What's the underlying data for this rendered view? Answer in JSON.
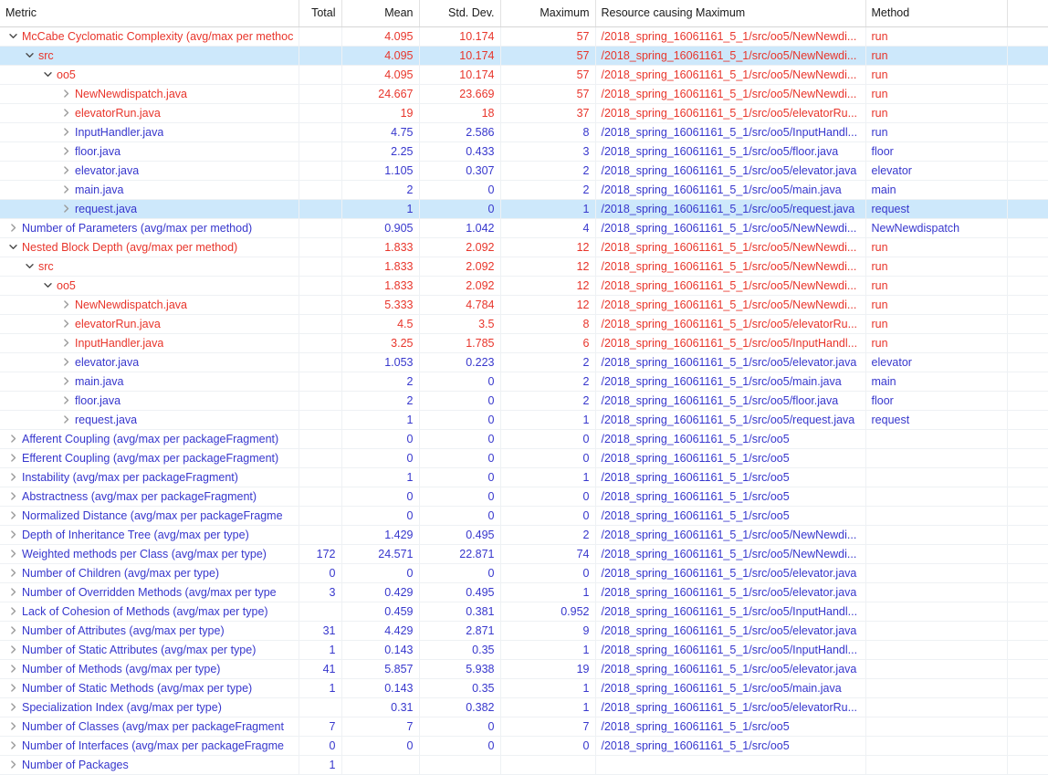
{
  "columns": [
    {
      "key": "metric",
      "label": "Metric",
      "align": "left"
    },
    {
      "key": "total",
      "label": "Total",
      "align": "right"
    },
    {
      "key": "mean",
      "label": "Mean",
      "align": "right"
    },
    {
      "key": "std",
      "label": "Std. Dev.",
      "align": "right"
    },
    {
      "key": "max",
      "label": "Maximum",
      "align": "right"
    },
    {
      "key": "resource",
      "label": "Resource causing Maximum",
      "align": "left"
    },
    {
      "key": "method",
      "label": "Method",
      "align": "left"
    }
  ],
  "icons": {
    "expanded": "chevron-down-icon",
    "collapsed": "chevron-right-icon"
  },
  "colors": {
    "over_threshold": "#e8352b",
    "normal": "#3737cd",
    "selection": "#cde8fb",
    "header_text": "#1a1a1a",
    "grid": "#eef1f4"
  },
  "rows": [
    {
      "label": "McCabe Cyclomatic Complexity (avg/max per methoc",
      "indent": 0,
      "state": "expanded",
      "color": "red",
      "selected": false,
      "total": "",
      "mean": "4.095",
      "std": "10.174",
      "max": "57",
      "resource": "/2018_spring_16061161_5_1/src/oo5/NewNewdi...",
      "method": "run"
    },
    {
      "label": "src",
      "indent": 1,
      "state": "expanded",
      "color": "red",
      "selected": true,
      "total": "",
      "mean": "4.095",
      "std": "10.174",
      "max": "57",
      "resource": "/2018_spring_16061161_5_1/src/oo5/NewNewdi...",
      "method": "run"
    },
    {
      "label": "oo5",
      "indent": 2,
      "state": "expanded",
      "color": "red",
      "selected": false,
      "total": "",
      "mean": "4.095",
      "std": "10.174",
      "max": "57",
      "resource": "/2018_spring_16061161_5_1/src/oo5/NewNewdi...",
      "method": "run"
    },
    {
      "label": "NewNewdispatch.java",
      "indent": 3,
      "state": "collapsed",
      "color": "red",
      "selected": false,
      "total": "",
      "mean": "24.667",
      "std": "23.669",
      "max": "57",
      "resource": "/2018_spring_16061161_5_1/src/oo5/NewNewdi...",
      "method": "run"
    },
    {
      "label": "elevatorRun.java",
      "indent": 3,
      "state": "collapsed",
      "color": "red",
      "selected": false,
      "total": "",
      "mean": "19",
      "std": "18",
      "max": "37",
      "resource": "/2018_spring_16061161_5_1/src/oo5/elevatorRu...",
      "method": "run"
    },
    {
      "label": "InputHandler.java",
      "indent": 3,
      "state": "collapsed",
      "color": "blue",
      "selected": false,
      "total": "",
      "mean": "4.75",
      "std": "2.586",
      "max": "8",
      "resource": "/2018_spring_16061161_5_1/src/oo5/InputHandl...",
      "method": "run"
    },
    {
      "label": "floor.java",
      "indent": 3,
      "state": "collapsed",
      "color": "blue",
      "selected": false,
      "total": "",
      "mean": "2.25",
      "std": "0.433",
      "max": "3",
      "resource": "/2018_spring_16061161_5_1/src/oo5/floor.java",
      "method": "floor"
    },
    {
      "label": "elevator.java",
      "indent": 3,
      "state": "collapsed",
      "color": "blue",
      "selected": false,
      "total": "",
      "mean": "1.105",
      "std": "0.307",
      "max": "2",
      "resource": "/2018_spring_16061161_5_1/src/oo5/elevator.java",
      "method": "elevator"
    },
    {
      "label": "main.java",
      "indent": 3,
      "state": "collapsed",
      "color": "blue",
      "selected": false,
      "total": "",
      "mean": "2",
      "std": "0",
      "max": "2",
      "resource": "/2018_spring_16061161_5_1/src/oo5/main.java",
      "method": "main"
    },
    {
      "label": "request.java",
      "indent": 3,
      "state": "collapsed",
      "color": "blue",
      "selected": true,
      "total": "",
      "mean": "1",
      "std": "0",
      "max": "1",
      "resource": "/2018_spring_16061161_5_1/src/oo5/request.java",
      "method": "request"
    },
    {
      "label": "Number of Parameters (avg/max per method)",
      "indent": 0,
      "state": "collapsed",
      "color": "blue",
      "selected": false,
      "total": "",
      "mean": "0.905",
      "std": "1.042",
      "max": "4",
      "resource": "/2018_spring_16061161_5_1/src/oo5/NewNewdi...",
      "method": "NewNewdispatch"
    },
    {
      "label": "Nested Block Depth (avg/max per method)",
      "indent": 0,
      "state": "expanded",
      "color": "red",
      "selected": false,
      "total": "",
      "mean": "1.833",
      "std": "2.092",
      "max": "12",
      "resource": "/2018_spring_16061161_5_1/src/oo5/NewNewdi...",
      "method": "run"
    },
    {
      "label": "src",
      "indent": 1,
      "state": "expanded",
      "color": "red",
      "selected": false,
      "total": "",
      "mean": "1.833",
      "std": "2.092",
      "max": "12",
      "resource": "/2018_spring_16061161_5_1/src/oo5/NewNewdi...",
      "method": "run"
    },
    {
      "label": "oo5",
      "indent": 2,
      "state": "expanded",
      "color": "red",
      "selected": false,
      "total": "",
      "mean": "1.833",
      "std": "2.092",
      "max": "12",
      "resource": "/2018_spring_16061161_5_1/src/oo5/NewNewdi...",
      "method": "run"
    },
    {
      "label": "NewNewdispatch.java",
      "indent": 3,
      "state": "collapsed",
      "color": "red",
      "selected": false,
      "total": "",
      "mean": "5.333",
      "std": "4.784",
      "max": "12",
      "resource": "/2018_spring_16061161_5_1/src/oo5/NewNewdi...",
      "method": "run"
    },
    {
      "label": "elevatorRun.java",
      "indent": 3,
      "state": "collapsed",
      "color": "red",
      "selected": false,
      "total": "",
      "mean": "4.5",
      "std": "3.5",
      "max": "8",
      "resource": "/2018_spring_16061161_5_1/src/oo5/elevatorRu...",
      "method": "run"
    },
    {
      "label": "InputHandler.java",
      "indent": 3,
      "state": "collapsed",
      "color": "red",
      "selected": false,
      "total": "",
      "mean": "3.25",
      "std": "1.785",
      "max": "6",
      "resource": "/2018_spring_16061161_5_1/src/oo5/InputHandl...",
      "method": "run"
    },
    {
      "label": "elevator.java",
      "indent": 3,
      "state": "collapsed",
      "color": "blue",
      "selected": false,
      "total": "",
      "mean": "1.053",
      "std": "0.223",
      "max": "2",
      "resource": "/2018_spring_16061161_5_1/src/oo5/elevator.java",
      "method": "elevator"
    },
    {
      "label": "main.java",
      "indent": 3,
      "state": "collapsed",
      "color": "blue",
      "selected": false,
      "total": "",
      "mean": "2",
      "std": "0",
      "max": "2",
      "resource": "/2018_spring_16061161_5_1/src/oo5/main.java",
      "method": "main"
    },
    {
      "label": "floor.java",
      "indent": 3,
      "state": "collapsed",
      "color": "blue",
      "selected": false,
      "total": "",
      "mean": "2",
      "std": "0",
      "max": "2",
      "resource": "/2018_spring_16061161_5_1/src/oo5/floor.java",
      "method": "floor"
    },
    {
      "label": "request.java",
      "indent": 3,
      "state": "collapsed",
      "color": "blue",
      "selected": false,
      "total": "",
      "mean": "1",
      "std": "0",
      "max": "1",
      "resource": "/2018_spring_16061161_5_1/src/oo5/request.java",
      "method": "request"
    },
    {
      "label": "Afferent Coupling (avg/max per packageFragment)",
      "indent": 0,
      "state": "collapsed",
      "color": "blue",
      "selected": false,
      "total": "",
      "mean": "0",
      "std": "0",
      "max": "0",
      "resource": "/2018_spring_16061161_5_1/src/oo5",
      "method": ""
    },
    {
      "label": "Efferent Coupling (avg/max per packageFragment)",
      "indent": 0,
      "state": "collapsed",
      "color": "blue",
      "selected": false,
      "total": "",
      "mean": "0",
      "std": "0",
      "max": "0",
      "resource": "/2018_spring_16061161_5_1/src/oo5",
      "method": ""
    },
    {
      "label": "Instability (avg/max per packageFragment)",
      "indent": 0,
      "state": "collapsed",
      "color": "blue",
      "selected": false,
      "total": "",
      "mean": "1",
      "std": "0",
      "max": "1",
      "resource": "/2018_spring_16061161_5_1/src/oo5",
      "method": ""
    },
    {
      "label": "Abstractness (avg/max per packageFragment)",
      "indent": 0,
      "state": "collapsed",
      "color": "blue",
      "selected": false,
      "total": "",
      "mean": "0",
      "std": "0",
      "max": "0",
      "resource": "/2018_spring_16061161_5_1/src/oo5",
      "method": ""
    },
    {
      "label": "Normalized Distance (avg/max per packageFragme",
      "indent": 0,
      "state": "collapsed",
      "color": "blue",
      "selected": false,
      "total": "",
      "mean": "0",
      "std": "0",
      "max": "0",
      "resource": "/2018_spring_16061161_5_1/src/oo5",
      "method": ""
    },
    {
      "label": "Depth of Inheritance Tree (avg/max per type)",
      "indent": 0,
      "state": "collapsed",
      "color": "blue",
      "selected": false,
      "total": "",
      "mean": "1.429",
      "std": "0.495",
      "max": "2",
      "resource": "/2018_spring_16061161_5_1/src/oo5/NewNewdi...",
      "method": ""
    },
    {
      "label": "Weighted methods per Class (avg/max per type)",
      "indent": 0,
      "state": "collapsed",
      "color": "blue",
      "selected": false,
      "total": "172",
      "mean": "24.571",
      "std": "22.871",
      "max": "74",
      "resource": "/2018_spring_16061161_5_1/src/oo5/NewNewdi...",
      "method": ""
    },
    {
      "label": "Number of Children (avg/max per type)",
      "indent": 0,
      "state": "collapsed",
      "color": "blue",
      "selected": false,
      "total": "0",
      "mean": "0",
      "std": "0",
      "max": "0",
      "resource": "/2018_spring_16061161_5_1/src/oo5/elevator.java",
      "method": ""
    },
    {
      "label": "Number of Overridden Methods (avg/max per type",
      "indent": 0,
      "state": "collapsed",
      "color": "blue",
      "selected": false,
      "total": "3",
      "mean": "0.429",
      "std": "0.495",
      "max": "1",
      "resource": "/2018_spring_16061161_5_1/src/oo5/elevator.java",
      "method": ""
    },
    {
      "label": "Lack of Cohesion of Methods (avg/max per type)",
      "indent": 0,
      "state": "collapsed",
      "color": "blue",
      "selected": false,
      "total": "",
      "mean": "0.459",
      "std": "0.381",
      "max": "0.952",
      "resource": "/2018_spring_16061161_5_1/src/oo5/InputHandl...",
      "method": ""
    },
    {
      "label": "Number of Attributes (avg/max per type)",
      "indent": 0,
      "state": "collapsed",
      "color": "blue",
      "selected": false,
      "total": "31",
      "mean": "4.429",
      "std": "2.871",
      "max": "9",
      "resource": "/2018_spring_16061161_5_1/src/oo5/elevator.java",
      "method": ""
    },
    {
      "label": "Number of Static Attributes (avg/max per type)",
      "indent": 0,
      "state": "collapsed",
      "color": "blue",
      "selected": false,
      "total": "1",
      "mean": "0.143",
      "std": "0.35",
      "max": "1",
      "resource": "/2018_spring_16061161_5_1/src/oo5/InputHandl...",
      "method": ""
    },
    {
      "label": "Number of Methods (avg/max per type)",
      "indent": 0,
      "state": "collapsed",
      "color": "blue",
      "selected": false,
      "total": "41",
      "mean": "5.857",
      "std": "5.938",
      "max": "19",
      "resource": "/2018_spring_16061161_5_1/src/oo5/elevator.java",
      "method": ""
    },
    {
      "label": "Number of Static Methods (avg/max per type)",
      "indent": 0,
      "state": "collapsed",
      "color": "blue",
      "selected": false,
      "total": "1",
      "mean": "0.143",
      "std": "0.35",
      "max": "1",
      "resource": "/2018_spring_16061161_5_1/src/oo5/main.java",
      "method": ""
    },
    {
      "label": "Specialization Index (avg/max per type)",
      "indent": 0,
      "state": "collapsed",
      "color": "blue",
      "selected": false,
      "total": "",
      "mean": "0.31",
      "std": "0.382",
      "max": "1",
      "resource": "/2018_spring_16061161_5_1/src/oo5/elevatorRu...",
      "method": ""
    },
    {
      "label": "Number of Classes (avg/max per packageFragment",
      "indent": 0,
      "state": "collapsed",
      "color": "blue",
      "selected": false,
      "total": "7",
      "mean": "7",
      "std": "0",
      "max": "7",
      "resource": "/2018_spring_16061161_5_1/src/oo5",
      "method": ""
    },
    {
      "label": "Number of Interfaces (avg/max per packageFragme",
      "indent": 0,
      "state": "collapsed",
      "color": "blue",
      "selected": false,
      "total": "0",
      "mean": "0",
      "std": "0",
      "max": "0",
      "resource": "/2018_spring_16061161_5_1/src/oo5",
      "method": ""
    },
    {
      "label": "Number of Packages",
      "indent": 0,
      "state": "collapsed",
      "color": "blue",
      "selected": false,
      "total": "1",
      "mean": "",
      "std": "",
      "max": "",
      "resource": "",
      "method": ""
    }
  ]
}
